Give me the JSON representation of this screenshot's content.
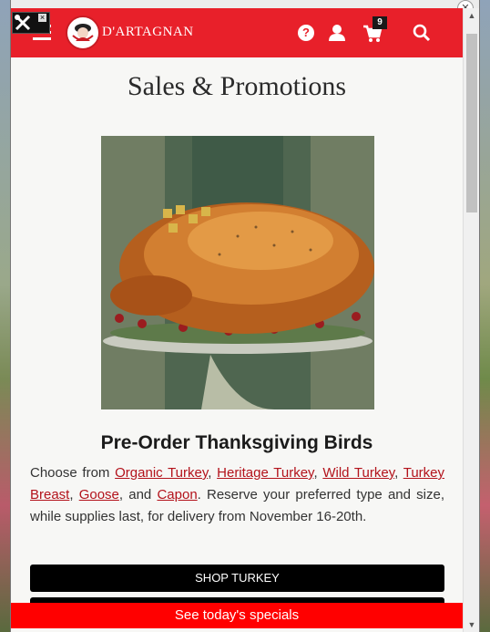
{
  "site": {
    "brand": "D'ARTAGNAN",
    "cart_count": "9"
  },
  "page": {
    "title": "Sales & Promotions"
  },
  "promo": {
    "heading": "Pre-Order Thanksgiving Birds",
    "text_intro": "Choose from ",
    "links": [
      "Organic Turkey",
      "Heritage Turkey",
      "Wild Turkey",
      "Turkey Breast",
      "Goose",
      "Capon"
    ],
    "sep1": ", ",
    "sep_and": ", and ",
    "text_outro": ". Reserve your preferred type and size, while supplies last, for delivery from November 16-20th.",
    "shop_button": "SHOP TURKEY"
  },
  "sticky_bar": {
    "label": "See today's specials"
  },
  "colors": {
    "brand_red": "#e8202a",
    "sticky_red": "#ff0000",
    "link_red": "#b3121b"
  },
  "icons": [
    "hamburger-menu-icon",
    "help-icon",
    "user-icon",
    "cart-icon",
    "search-icon",
    "tools-icon"
  ]
}
